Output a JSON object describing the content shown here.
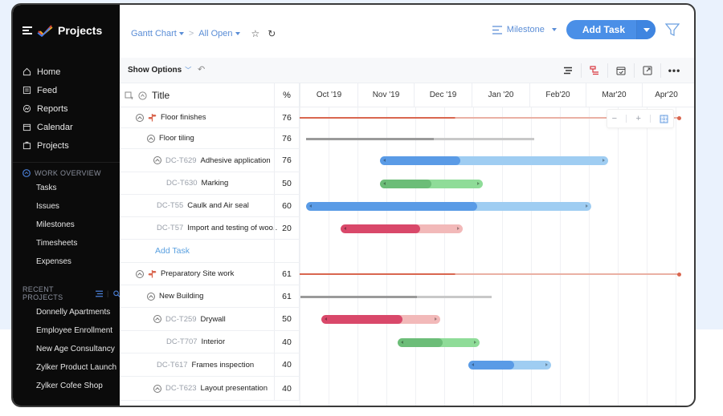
{
  "sidebar": {
    "brand": "Projects",
    "nav": [
      {
        "label": "Home",
        "icon": "home-icon"
      },
      {
        "label": "Feed",
        "icon": "feed-icon"
      },
      {
        "label": "Reports",
        "icon": "reports-icon"
      },
      {
        "label": "Calendar",
        "icon": "calendar-icon"
      },
      {
        "label": "Projects",
        "icon": "briefcase-icon"
      }
    ],
    "work_overview": {
      "heading": "WORK OVERVIEW",
      "items": [
        "Tasks",
        "Issues",
        "Milestones",
        "Timesheets",
        "Expenses"
      ]
    },
    "recent_projects": {
      "heading": "RECENT PROJECTS",
      "items": [
        "Donnelly Apartments",
        "Employee Enrollment",
        "New Age Consultancy",
        "Zylker Product Launch",
        "Zylker Cofee Shop"
      ]
    }
  },
  "topbar": {
    "view": "Gantt Chart",
    "filter": "All Open",
    "milestone": "Milestone",
    "add_task": "Add Task"
  },
  "toolbar": {
    "show_options": "Show Options"
  },
  "grid": {
    "title_header": "Title",
    "pct_header": "%",
    "months": [
      "Oct '19",
      "Nov '19",
      "Dec '19",
      "Jan '20",
      "Feb'20",
      "Mar'20",
      "Apr'20"
    ],
    "add_task_link": "Add Task",
    "rows": [
      {
        "code": "",
        "name": "Floor finishes",
        "pct": "76",
        "type": "milestone",
        "level": 0
      },
      {
        "code": "",
        "name": "Floor tiling",
        "pct": "76",
        "type": "group",
        "level": 1
      },
      {
        "code": "DC-T629",
        "name": "Adhesive application",
        "pct": "76",
        "type": "task",
        "level": 2,
        "collapsible": true
      },
      {
        "code": "DC-T630",
        "name": "Marking",
        "pct": "50",
        "type": "task",
        "level": 3
      },
      {
        "code": "DC-T55",
        "name": "Caulk and Air seal",
        "pct": "60",
        "type": "task",
        "level": 1
      },
      {
        "code": "DC-T57",
        "name": "Import and testing of woo..",
        "pct": "20",
        "type": "task",
        "level": 1
      },
      {
        "code": "",
        "name": "",
        "pct": "",
        "type": "addtask",
        "level": 1
      },
      {
        "code": "",
        "name": "Preparatory Site work",
        "pct": "61",
        "type": "milestone",
        "level": 0
      },
      {
        "code": "",
        "name": "New Building",
        "pct": "61",
        "type": "group",
        "level": 1
      },
      {
        "code": "DC-T259",
        "name": "Drywall",
        "pct": "50",
        "type": "task",
        "level": 2,
        "collapsible": true
      },
      {
        "code": "DC-T707",
        "name": "Interior",
        "pct": "40",
        "type": "task",
        "level": 3
      },
      {
        "code": "DC-T617",
        "name": "Frames inspection",
        "pct": "40",
        "type": "task",
        "level": 1
      },
      {
        "code": "DC-T623",
        "name": "Layout presentation",
        "pct": "40",
        "type": "task",
        "level": 2,
        "collapsible": true
      }
    ]
  },
  "gantt": {
    "colors": {
      "blue": "#5a9be6",
      "blue_light": "#9fcdf2",
      "green": "#6cbd78",
      "green_light": "#8fdc98",
      "red": "#d9486a",
      "red_light": "#f2b9b9",
      "milestone": "#d9664f",
      "milestone_light": "#eab0a4",
      "group": "#9a9a9a",
      "group_light": "#c8c8c8"
    },
    "bars": [
      {
        "row": 0,
        "kind": "milestone",
        "start": 0.0,
        "end": 0.97,
        "progress": 0.76
      },
      {
        "row": 1,
        "kind": "group",
        "start": 0.45,
        "end": 4.45,
        "progress": 0.56
      },
      {
        "row": 2,
        "kind": "blue",
        "start": 1.75,
        "end": 5.75,
        "progress": 0.35
      },
      {
        "row": 3,
        "kind": "green",
        "start": 1.75,
        "end": 3.55,
        "progress": 0.5
      },
      {
        "row": 4,
        "kind": "blue",
        "start": 0.45,
        "end": 5.45,
        "progress": 0.6
      },
      {
        "row": 5,
        "kind": "red",
        "start": 1.05,
        "end": 3.2,
        "progress": 0.65
      },
      {
        "row": 7,
        "kind": "milestone",
        "start": 0.0,
        "end": 0.97,
        "progress": 0.61
      },
      {
        "row": 8,
        "kind": "group",
        "start": 0.35,
        "end": 3.7,
        "progress": 0.61
      },
      {
        "row": 9,
        "kind": "red",
        "start": 0.72,
        "end": 2.8,
        "progress": 0.68
      },
      {
        "row": 10,
        "kind": "green",
        "start": 2.05,
        "end": 3.5,
        "progress": 0.55
      },
      {
        "row": 11,
        "kind": "blue",
        "start": 3.3,
        "end": 4.75,
        "progress": 0.55
      }
    ]
  }
}
